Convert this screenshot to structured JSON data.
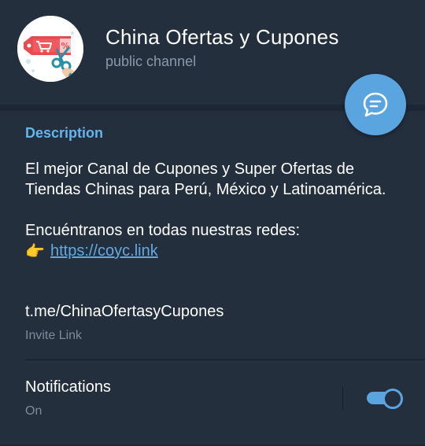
{
  "header": {
    "title": "China Ofertas y Cupones",
    "subtitle": "public channel",
    "avatar_icon": "shopping-cart-coupon-logo"
  },
  "fab": {
    "icon": "chat-bubble-icon"
  },
  "info": {
    "section_label": "Description",
    "description_line1": "El mejor Canal de Cupones y Super Ofertas de Tiendas Chinas para Perú, México y Latinoamérica.",
    "description_line2": "Encuéntranos en todas nuestras redes:",
    "pointing_emoji": "👉",
    "link_text": "https://coyc.link",
    "invite_link": "t.me/ChinaOfertasyCupones",
    "invite_label": "Invite Link"
  },
  "notifications": {
    "label": "Notifications",
    "status": "On",
    "enabled": true
  },
  "colors": {
    "background": "#1d2733",
    "panel": "#242f3d",
    "accent": "#5aa4e0",
    "link": "#62a9e3",
    "section_label": "#64b4ef",
    "muted": "#7d8b99"
  }
}
